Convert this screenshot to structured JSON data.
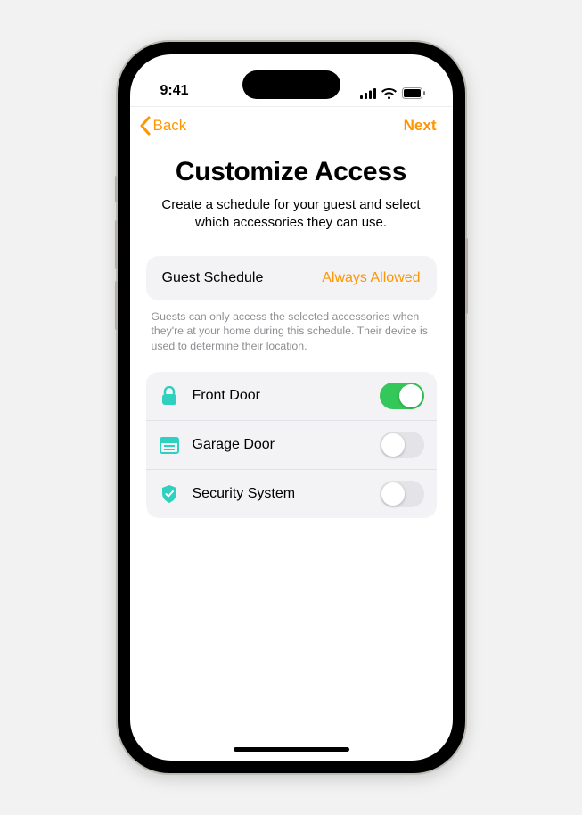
{
  "status": {
    "time": "9:41"
  },
  "nav": {
    "back_label": "Back",
    "next_label": "Next"
  },
  "title": "Customize Access",
  "subtitle": "Create a schedule for your guest and select which accessories they can use.",
  "schedule": {
    "label": "Guest Schedule",
    "value": "Always Allowed"
  },
  "footnote": "Guests can only access the selected accessories when they're at your home during this schedule. Their device is used to determine their location.",
  "accessories": [
    {
      "label": "Front Door",
      "on": true
    },
    {
      "label": "Garage Door",
      "on": false
    },
    {
      "label": "Security System",
      "on": false
    }
  ],
  "colors": {
    "accent": "#ff9500",
    "icon": "#30d0c0",
    "toggle_on": "#34c759"
  }
}
